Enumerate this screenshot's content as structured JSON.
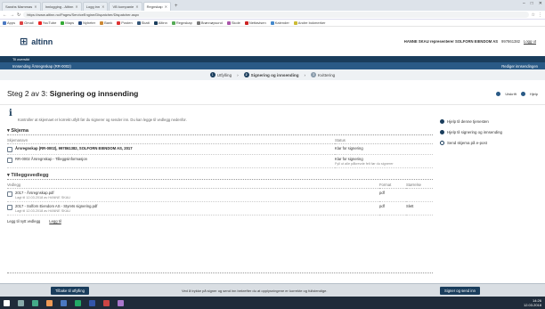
{
  "browser": {
    "tabs": [
      {
        "label": "Sarahs Mammas"
      },
      {
        "label": "Innlogging - Altinn"
      },
      {
        "label": "Logg inn"
      },
      {
        "label": "VB kompanie"
      },
      {
        "label": "Regnskap"
      }
    ],
    "url": "https://www.altinn.no/Pages/ServiceEngine/Dispatcher/Dispatcher.aspx",
    "bookmarks": [
      "Apps",
      "Gmail",
      "YouTube",
      "Maps",
      "Nyheter",
      "Bank",
      "Posten",
      "Skatt",
      "Altinn",
      "Regnskap",
      "Brønnøysund",
      "Skole",
      "Nettavisen",
      "Kalender",
      "Andre bokmerker"
    ]
  },
  "header": {
    "logo_text": "altinn",
    "user_name": "HANNE SKAU representerer SOLFORN EIENDOM AS",
    "user_id": "997861382",
    "logout": "Logg ut"
  },
  "ribbon": {
    "home": "Til oversikt",
    "service": "Innsending Årsregnskap (RR-0002)",
    "right": "Rediger innsendingen"
  },
  "steps": [
    {
      "num": "1",
      "label": "Utfylling"
    },
    {
      "num": "2",
      "label": "Signering og innsending"
    },
    {
      "num": "3",
      "label": "Kvittering"
    }
  ],
  "title": {
    "prefix": "Steg 2 av 3: ",
    "bold": "Signering og innsending"
  },
  "title_tools": {
    "print": "Utskrift",
    "help": "Hjelp"
  },
  "info_text": "Kontroller at skjemaet er korrekt utfylt før du signerer og sender inn. Du kan legge til vedlegg nedenfor.",
  "skjema": {
    "heading": "Skjema",
    "col_name": "Skjemanavn",
    "col_status": "Status",
    "rows": [
      {
        "title": "Årsregnskap (RR-0002), 997861382, SOLFORN EIENDOM AS, 2017",
        "sub": "",
        "status": "Klar for signering"
      },
      {
        "title": "RR-0002 Årsregnskap - Tilleggsinformasjon",
        "sub": "",
        "status": "Klar for signering"
      }
    ],
    "note": "Fyll ut alle påkrevde felt før du signerer"
  },
  "vedlegg": {
    "heading": "Tilleggsvedlegg",
    "col_name": "Vedlegg",
    "col_type": "Format",
    "col_size": "Størrelse",
    "rows": [
      {
        "title": "2017 - Årsregnskap.pdf",
        "sub": "Lagt til 12.03.2018 av HANNE SKAU",
        "type": "pdf",
        "size": ""
      },
      {
        "title": "2017 - Solforn Eiendom AS - Styrets signering.pdf",
        "sub": "Lagt til 12.03.2018 av HANNE SKAU",
        "type": "pdf",
        "size": "Slett"
      }
    ],
    "add_label": "Legg til nytt vedlegg",
    "add_link": "Legg til"
  },
  "sidebar": [
    {
      "label": "Hjelp til denne tjenesten"
    },
    {
      "label": "Hjelp til signering og innsending"
    },
    {
      "label": "Send skjema på e-post"
    }
  ],
  "bottom": {
    "back": "Tilbake til utfylling",
    "message": "Ved å trykke på signer og send inn bekrefter du at opplysningene er korrekte og fullstendige.",
    "next": "Signer og send inn"
  },
  "taskbar": {
    "time": "14:26",
    "date": "12.03.2018"
  }
}
